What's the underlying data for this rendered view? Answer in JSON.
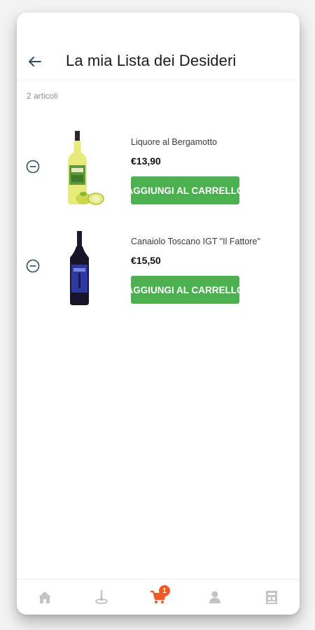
{
  "header": {
    "back_icon": "arrow-left-icon",
    "title": "La mia Lista dei Desideri"
  },
  "wishlist": {
    "count_label": "2 articoli",
    "items": [
      {
        "name": "Liquore al Bergamotto",
        "price": "€13,90",
        "button_label": "AGGIUNGI AL CARRELLO",
        "remove_icon": "minus-circle-icon",
        "image": "bergamot-liqueur-bottle"
      },
      {
        "name": "Canaiolo Toscano IGT \"Il Fattore\"",
        "price": "€15,50",
        "button_label": "AGGIUNGI AL CARRELLO",
        "remove_icon": "minus-circle-icon",
        "image": "red-wine-bottle"
      }
    ]
  },
  "bottom_nav": {
    "items": [
      {
        "icon": "home-icon",
        "active": false
      },
      {
        "icon": "map-pin-icon",
        "active": false
      },
      {
        "icon": "cart-icon",
        "active": true,
        "badge": "1"
      },
      {
        "icon": "user-icon",
        "active": false
      },
      {
        "icon": "store-icon",
        "active": false
      }
    ]
  },
  "colors": {
    "button_green": "#4caf50",
    "accent_orange": "#f05a28",
    "icon_teal": "#2f4f5f",
    "nav_gray": "#c4c4c4"
  }
}
